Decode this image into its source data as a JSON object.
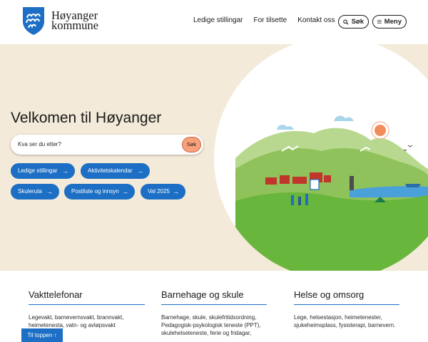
{
  "brand": {
    "name_line1": "Høyanger",
    "name_line2": "kommune",
    "shield_color": "#1c6fc4",
    "accent_color": "#1c6fc4"
  },
  "nav": {
    "items": [
      "Ledige stillingar",
      "For tilsette",
      "Kontakt oss"
    ],
    "search_label": "Søk",
    "menu_label": "Meny"
  },
  "hero": {
    "title": "Velkomen til Høyanger",
    "search_placeholder": "Kva ser du etter?",
    "search_button": "Søk",
    "quick_links": [
      "Ledige stillingar",
      "Aktivitetskalendar",
      "Skuleruta",
      "Postliste og innsyn",
      "Val 2025"
    ]
  },
  "cards": [
    {
      "title": "Vakttelefonar",
      "text": "Legevakt, barnevernsvakt, brannvakt, heimetenesta, vatn- og avløpsvakt"
    },
    {
      "title": "Barnehage og skule",
      "text": "Barnehage, skule, skulefritidsordning, Pedagogisk-psykologisk teneste (PPT), skulehelseteneste, ferie og fridagar,"
    },
    {
      "title": "Helse og omsorg",
      "text": "Lege, helsestasjon, heimetenester, sjukeheimsplass, fysioterapi, barnevern."
    }
  ],
  "to_top": "Til toppen"
}
